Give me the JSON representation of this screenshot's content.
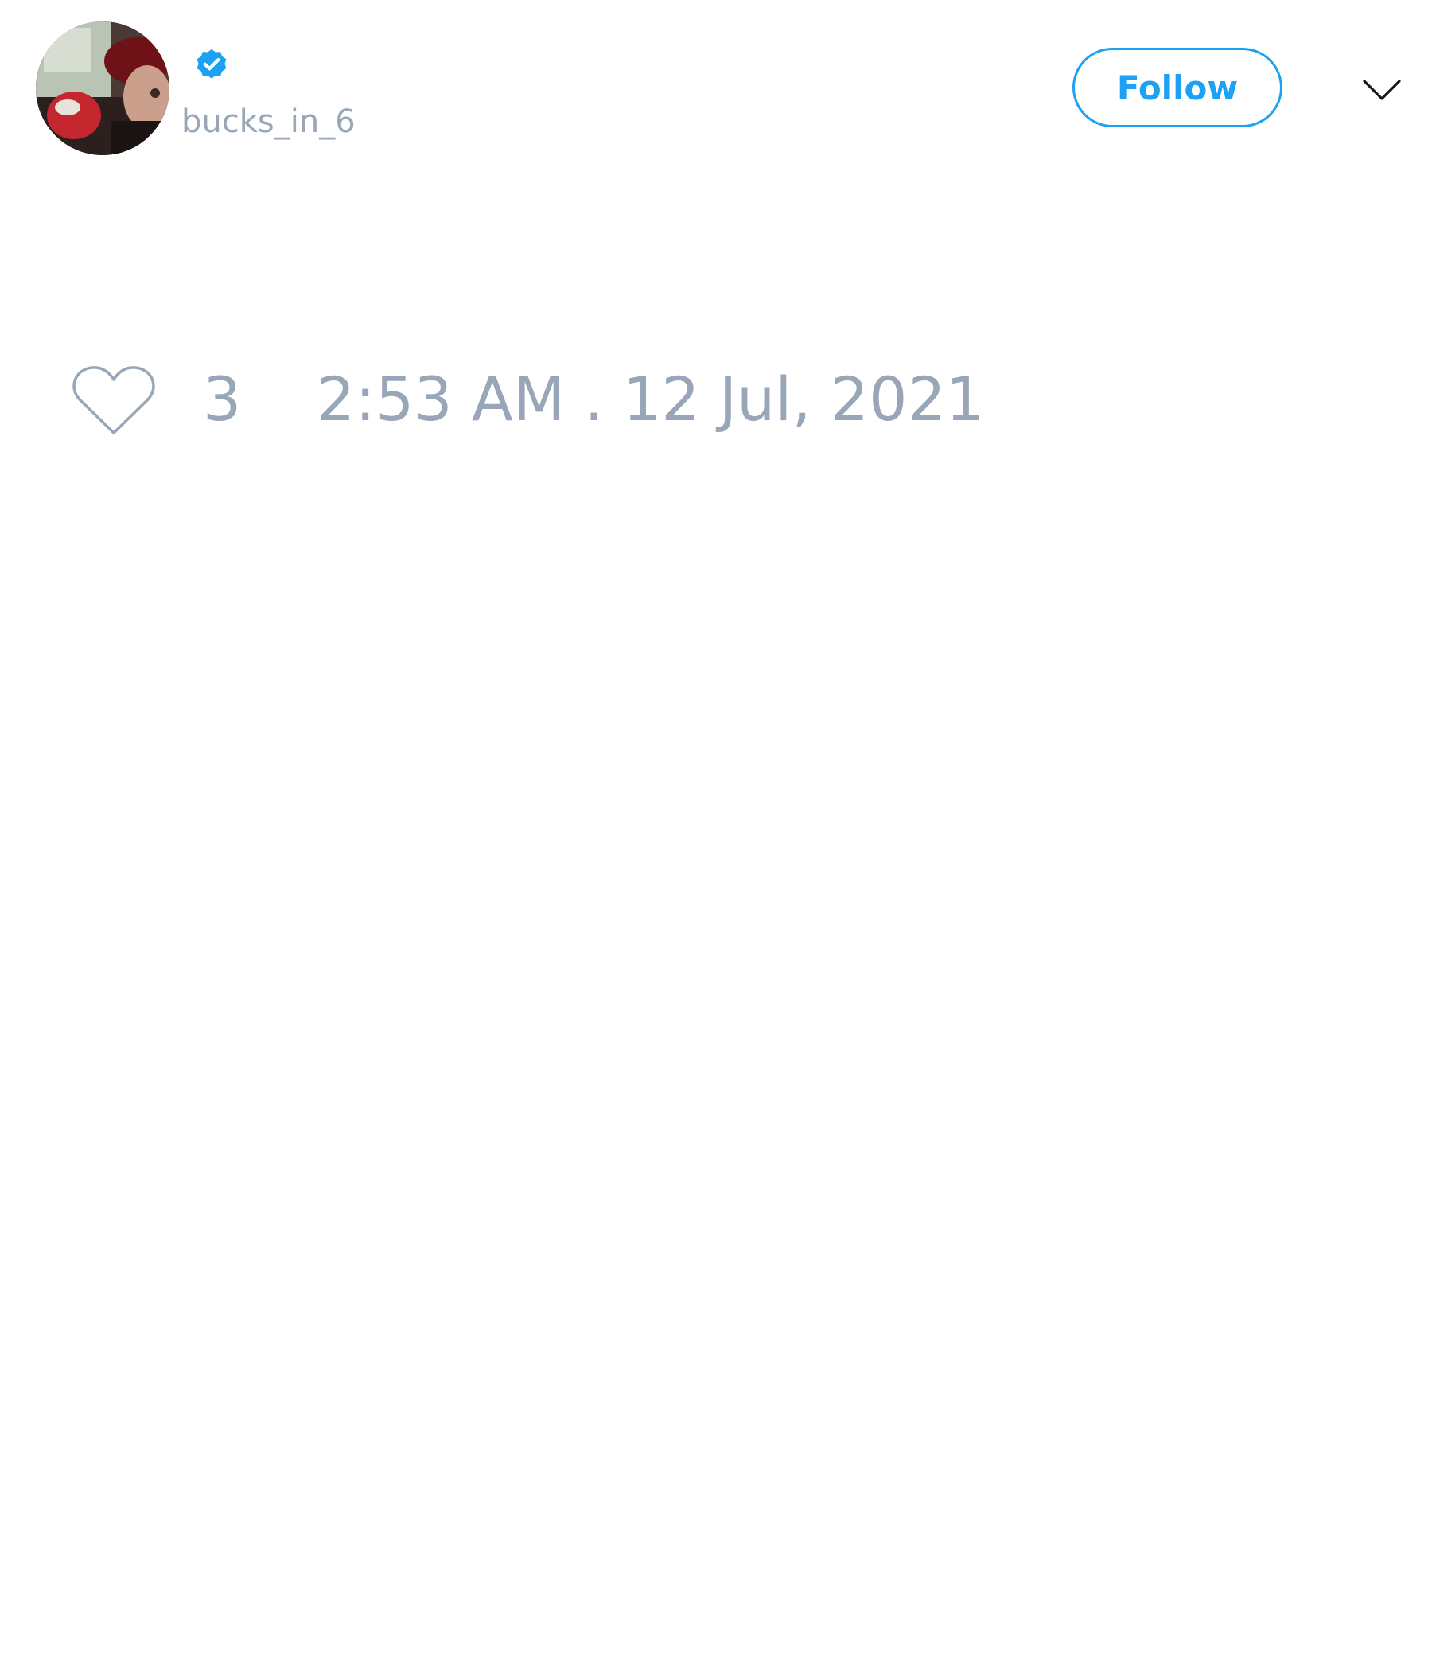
{
  "author": {
    "handle": "bucks_in_6",
    "verified": true,
    "avatar_icon": "profile-photo"
  },
  "header": {
    "follow_label": "Follow",
    "menu_icon": "chevron-down-icon"
  },
  "engagement": {
    "like_icon": "heart-outline-icon",
    "like_count": "3",
    "timestamp": "2:53 AM . 12 Jul, 2021"
  },
  "colors": {
    "accent": "#1da1f2",
    "muted_text": "#98a6b8",
    "background": "#ffffff"
  }
}
